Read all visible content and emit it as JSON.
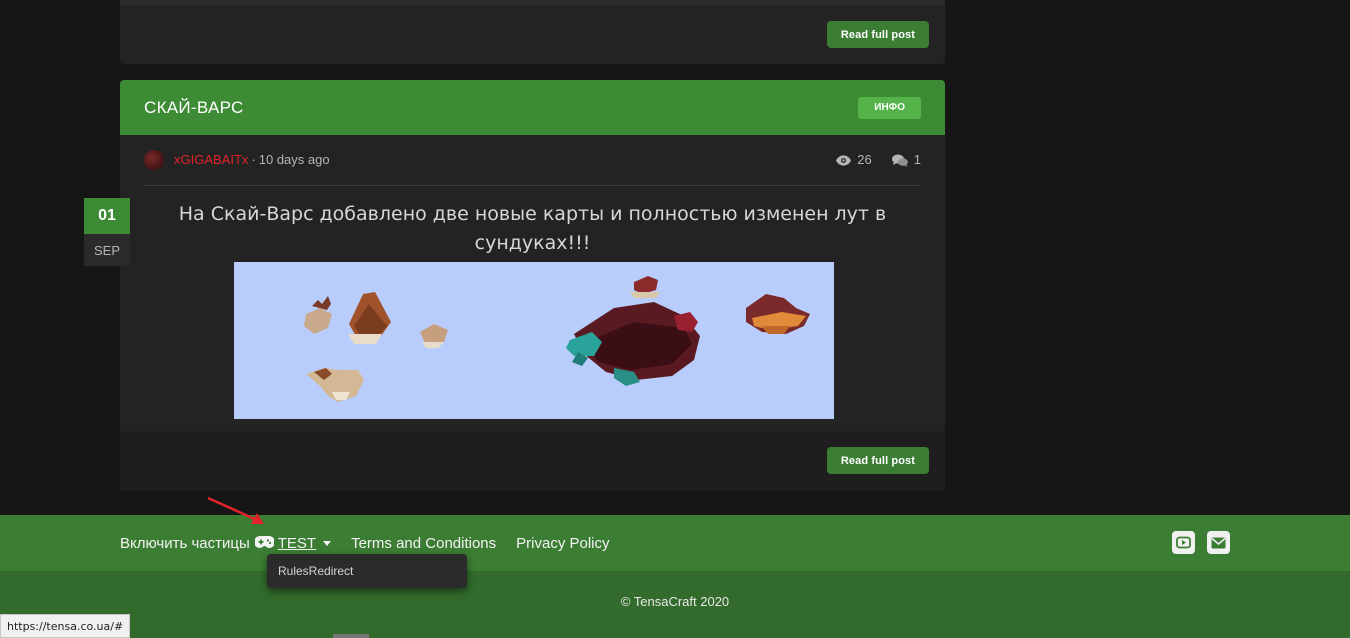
{
  "posts": {
    "previous": {
      "read_label": "Read full post"
    },
    "current": {
      "title": "СКАЙ-ВАРС",
      "badge": "ИНФО",
      "author": "xGIGABAITx",
      "separator": "·",
      "time_ago": "10 days ago",
      "views": "26",
      "comments": "1",
      "content": "На Скай-Варс добавлено две новые карты и полностью изменен лут в сундуках!!!",
      "date_day": "01",
      "date_month": "SEP",
      "read_label": "Read full post"
    }
  },
  "footer": {
    "particles_label": "Включить частицы",
    "dropdown_label": "TEST",
    "terms_label": "Terms and Conditions",
    "privacy_label": "Privacy Policy",
    "copyright": "© TensaCraft 2020",
    "dropdown_items": [
      "RulesRedirect"
    ]
  },
  "status_url": "https://tensa.co.ua/#",
  "colors": {
    "accent": "#3d8b34",
    "author": "#e0242a",
    "badge": "#54b44a",
    "background": "#161616"
  },
  "icons": [
    "eye-icon",
    "comments-icon",
    "gamepad-icon",
    "youtube-icon",
    "envelope-icon"
  ]
}
